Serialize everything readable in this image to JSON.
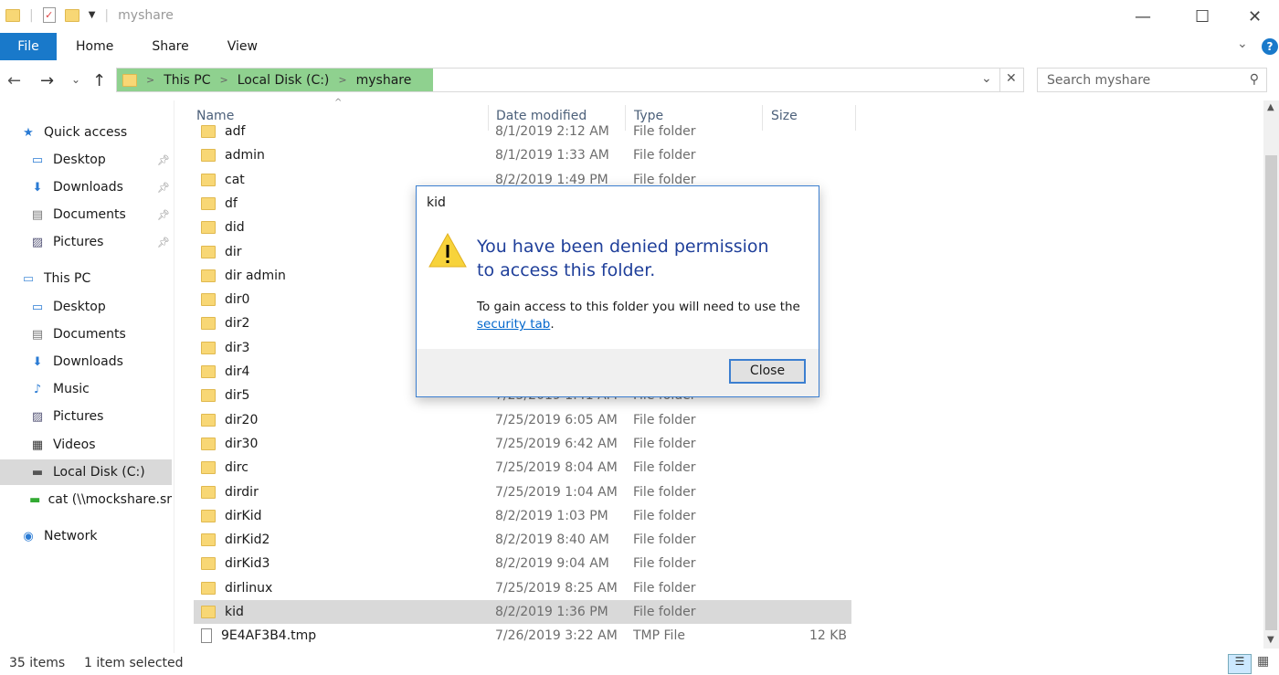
{
  "window": {
    "title": "myshare",
    "minimize": "—",
    "maximize": "☐",
    "close": "✕",
    "help": "?",
    "expand": "⌄"
  },
  "ribbon": {
    "tabs": [
      "File",
      "Home",
      "Share",
      "View"
    ]
  },
  "nav": {
    "back": "←",
    "forward": "→",
    "recent": "⌄",
    "up": "↑"
  },
  "address": {
    "crumbs": [
      "This PC",
      "Local Disk (C:)",
      "myshare"
    ],
    "dropdown": "⌄",
    "clear": "✕"
  },
  "search": {
    "placeholder": "Search myshare",
    "icon": "search-icon"
  },
  "sidebar": {
    "items": [
      {
        "label": "Quick access",
        "icon": "star-icon",
        "pinned": false
      },
      {
        "label": "Desktop",
        "icon": "desktop-icon",
        "pinned": true
      },
      {
        "label": "Downloads",
        "icon": "download-icon",
        "pinned": true
      },
      {
        "label": "Documents",
        "icon": "document-icon",
        "pinned": true
      },
      {
        "label": "Pictures",
        "icon": "pictures-icon",
        "pinned": true
      },
      {
        "label": "This PC",
        "icon": "computer-icon"
      },
      {
        "label": "Desktop",
        "icon": "desktop-icon"
      },
      {
        "label": "Documents",
        "icon": "document-icon"
      },
      {
        "label": "Downloads",
        "icon": "download-icon"
      },
      {
        "label": "Music",
        "icon": "music-icon"
      },
      {
        "label": "Pictures",
        "icon": "pictures-icon"
      },
      {
        "label": "Videos",
        "icon": "videos-icon"
      },
      {
        "label": "Local Disk (C:)",
        "icon": "drive-icon",
        "selected": true
      },
      {
        "label": "cat (\\\\mockshare.sr",
        "icon": "network-drive-icon"
      },
      {
        "label": "Network",
        "icon": "network-icon"
      }
    ]
  },
  "columns": {
    "name": "Name",
    "date": "Date modified",
    "type": "Type",
    "size": "Size"
  },
  "files": [
    {
      "name": "adf",
      "date": "8/1/2019 2:12 AM",
      "type": "File folder",
      "size": ""
    },
    {
      "name": "admin",
      "date": "8/1/2019 1:33 AM",
      "type": "File folder",
      "size": ""
    },
    {
      "name": "cat",
      "date": "8/2/2019 1:49 PM",
      "type": "File folder",
      "size": ""
    },
    {
      "name": "df",
      "date": "",
      "type": "",
      "size": ""
    },
    {
      "name": "did",
      "date": "",
      "type": "",
      "size": ""
    },
    {
      "name": "dir",
      "date": "",
      "type": "",
      "size": ""
    },
    {
      "name": "dir admin",
      "date": "",
      "type": "",
      "size": ""
    },
    {
      "name": "dir0",
      "date": "",
      "type": "",
      "size": ""
    },
    {
      "name": "dir2",
      "date": "",
      "type": "",
      "size": ""
    },
    {
      "name": "dir3",
      "date": "",
      "type": "",
      "size": ""
    },
    {
      "name": "dir4",
      "date": "",
      "type": "",
      "size": ""
    },
    {
      "name": "dir5",
      "date": "7/25/2019 1:41 AM",
      "type": "File folder",
      "size": ""
    },
    {
      "name": "dir20",
      "date": "7/25/2019 6:05 AM",
      "type": "File folder",
      "size": ""
    },
    {
      "name": "dir30",
      "date": "7/25/2019 6:42 AM",
      "type": "File folder",
      "size": ""
    },
    {
      "name": "dirc",
      "date": "7/25/2019 8:04 AM",
      "type": "File folder",
      "size": ""
    },
    {
      "name": "dirdir",
      "date": "7/25/2019 1:04 AM",
      "type": "File folder",
      "size": ""
    },
    {
      "name": "dirKid",
      "date": "8/2/2019 1:03 PM",
      "type": "File folder",
      "size": ""
    },
    {
      "name": "dirKid2",
      "date": "8/2/2019 8:40 AM",
      "type": "File folder",
      "size": ""
    },
    {
      "name": "dirKid3",
      "date": "8/2/2019 9:04 AM",
      "type": "File folder",
      "size": ""
    },
    {
      "name": "dirlinux",
      "date": "7/25/2019 8:25 AM",
      "type": "File folder",
      "size": ""
    },
    {
      "name": "kid",
      "date": "8/2/2019 1:36 PM",
      "type": "File folder",
      "size": "",
      "selected": true
    },
    {
      "name": "9E4AF3B4.tmp",
      "date": "7/26/2019 3:22 AM",
      "type": "TMP File",
      "size": "12 KB",
      "file": true
    }
  ],
  "status": {
    "count": "35 items",
    "selection": "1 item selected"
  },
  "dialog": {
    "title": "kid",
    "heading": "You have been denied permission to access this folder.",
    "body": "To gain access to this folder you will need to use the",
    "link": "security tab",
    "period": ".",
    "close": "Close",
    "icon": "warning-icon"
  },
  "colors": {
    "accent": "#1979ca",
    "breadcrumb_bg": "#8fd18f",
    "dialog_heading": "#1f3f9a",
    "link": "#0066cc"
  }
}
